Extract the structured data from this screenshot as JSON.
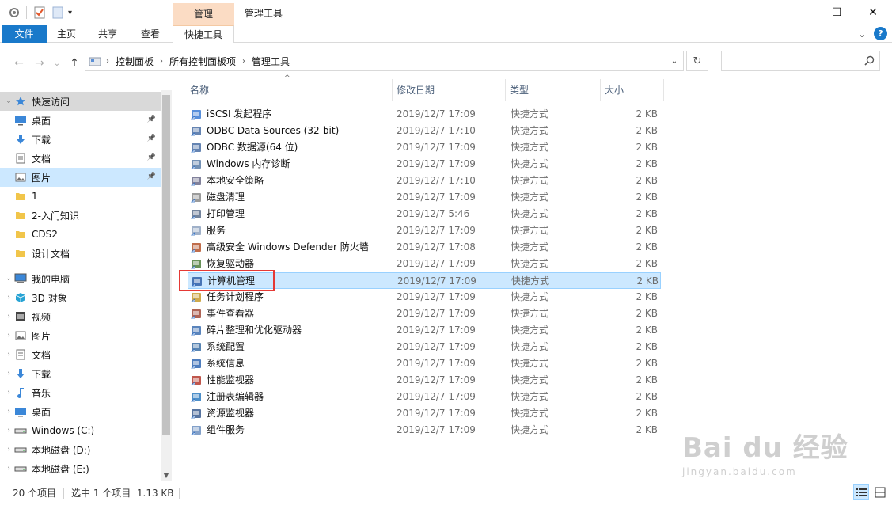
{
  "window": {
    "title": "管理工具",
    "context_tab_group": "管理",
    "controls": {
      "minimize": "—",
      "maximize": "☐",
      "close": "✕"
    }
  },
  "ribbon": {
    "tabs": [
      {
        "label": "文件"
      },
      {
        "label": "主页"
      },
      {
        "label": "共享"
      },
      {
        "label": "查看"
      },
      {
        "label": "快捷工具"
      }
    ],
    "expand": "⌄",
    "help": "?"
  },
  "address": {
    "crumbs": [
      "控制面板",
      "所有控制面板项",
      "管理工具"
    ],
    "nav": {
      "back": "←",
      "forward": "→",
      "recent": "⌄",
      "up": "↑"
    },
    "dropdown": "⌄",
    "refresh": "↻",
    "search_placeholder": ""
  },
  "navpane": {
    "items": [
      {
        "label": "快速访问",
        "icon": "star-icon",
        "color": "#3b87d8"
      },
      {
        "label": "桌面",
        "icon": "desktop-icon",
        "color": "#3b87d8"
      },
      {
        "label": "下载",
        "icon": "download-icon",
        "color": "#3b87d8"
      },
      {
        "label": "文档",
        "icon": "document-icon",
        "color": "#6d6d6d"
      },
      {
        "label": "图片",
        "icon": "picture-icon",
        "color": "#6d6d6d"
      },
      {
        "label": "1",
        "icon": "folder-icon",
        "color": "#f1c54a"
      },
      {
        "label": "2-入门知识",
        "icon": "folder-icon",
        "color": "#f1c54a"
      },
      {
        "label": "CDS2",
        "icon": "folder-icon",
        "color": "#f1c54a"
      },
      {
        "label": "设计文档",
        "icon": "folder-icon",
        "color": "#f1c54a"
      },
      {
        "label": "我的电脑",
        "icon": "computer-icon",
        "color": "#3b87d8"
      },
      {
        "label": "3D 对象",
        "icon": "3d-objects-icon",
        "color": "#27a3d4"
      },
      {
        "label": "视频",
        "icon": "video-icon",
        "color": "#444444"
      },
      {
        "label": "图片",
        "icon": "picture-icon",
        "color": "#6d6d6d"
      },
      {
        "label": "文档",
        "icon": "document-icon",
        "color": "#6d6d6d"
      },
      {
        "label": "下载",
        "icon": "download-icon",
        "color": "#3b87d8"
      },
      {
        "label": "音乐",
        "icon": "music-icon",
        "color": "#3b87d8"
      },
      {
        "label": "桌面",
        "icon": "desktop-icon",
        "color": "#3b87d8"
      },
      {
        "label": "Windows (C:)",
        "icon": "drive-icon",
        "color": "#555555"
      },
      {
        "label": "本地磁盘 (D:)",
        "icon": "drive-icon",
        "color": "#555555"
      },
      {
        "label": "本地磁盘 (E:)",
        "icon": "drive-icon",
        "color": "#555555"
      }
    ]
  },
  "filelist": {
    "columns": [
      "名称",
      "修改日期",
      "类型",
      "大小"
    ],
    "sort_indicator": "^",
    "rows": [
      {
        "name": "iSCSI 发起程序",
        "date": "2019/12/7 17:09",
        "type": "快捷方式",
        "size": "2 KB",
        "icon": "iscsi-icon",
        "color": "#3a7bd5"
      },
      {
        "name": "ODBC Data Sources (32-bit)",
        "date": "2019/12/7 17:10",
        "type": "快捷方式",
        "size": "2 KB",
        "icon": "odbc-icon",
        "color": "#4a6fa5"
      },
      {
        "name": "ODBC 数据源(64 位)",
        "date": "2019/12/7 17:09",
        "type": "快捷方式",
        "size": "2 KB",
        "icon": "odbc-icon",
        "color": "#4a6fa5"
      },
      {
        "name": "Windows 内存诊断",
        "date": "2019/12/7 17:09",
        "type": "快捷方式",
        "size": "2 KB",
        "icon": "memory-diagnostic-icon",
        "color": "#5b7ea8"
      },
      {
        "name": "本地安全策略",
        "date": "2019/12/7 17:10",
        "type": "快捷方式",
        "size": "2 KB",
        "icon": "security-policy-icon",
        "color": "#6b6b8a"
      },
      {
        "name": "磁盘清理",
        "date": "2019/12/7 17:09",
        "type": "快捷方式",
        "size": "2 KB",
        "icon": "disk-cleanup-icon",
        "color": "#8a8a8a"
      },
      {
        "name": "打印管理",
        "date": "2019/12/7 5:46",
        "type": "快捷方式",
        "size": "2 KB",
        "icon": "print-management-icon",
        "color": "#5a6e8c"
      },
      {
        "name": "服务",
        "date": "2019/12/7 17:09",
        "type": "快捷方式",
        "size": "2 KB",
        "icon": "services-icon",
        "color": "#8fa3bf"
      },
      {
        "name": "高级安全 Windows Defender 防火墙",
        "date": "2019/12/7 17:08",
        "type": "快捷方式",
        "size": "2 KB",
        "icon": "firewall-icon",
        "color": "#b5542b"
      },
      {
        "name": "恢复驱动器",
        "date": "2019/12/7 17:09",
        "type": "快捷方式",
        "size": "2 KB",
        "icon": "recovery-drive-icon",
        "color": "#4d7f3c"
      },
      {
        "name": "计算机管理",
        "date": "2019/12/7 17:09",
        "type": "快捷方式",
        "size": "2 KB",
        "icon": "computer-management-icon",
        "color": "#2f5fa8"
      },
      {
        "name": "任务计划程序",
        "date": "2019/12/7 17:09",
        "type": "快捷方式",
        "size": "2 KB",
        "icon": "task-scheduler-icon",
        "color": "#c69b2e"
      },
      {
        "name": "事件查看器",
        "date": "2019/12/7 17:09",
        "type": "快捷方式",
        "size": "2 KB",
        "icon": "event-viewer-icon",
        "color": "#a14a3a"
      },
      {
        "name": "碎片整理和优化驱动器",
        "date": "2019/12/7 17:09",
        "type": "快捷方式",
        "size": "2 KB",
        "icon": "defrag-icon",
        "color": "#3d6fb0"
      },
      {
        "name": "系统配置",
        "date": "2019/12/7 17:09",
        "type": "快捷方式",
        "size": "2 KB",
        "icon": "system-config-icon",
        "color": "#3b6ea5"
      },
      {
        "name": "系统信息",
        "date": "2019/12/7 17:09",
        "type": "快捷方式",
        "size": "2 KB",
        "icon": "system-info-icon",
        "color": "#2f66b3"
      },
      {
        "name": "性能监视器",
        "date": "2019/12/7 17:09",
        "type": "快捷方式",
        "size": "2 KB",
        "icon": "performance-monitor-icon",
        "color": "#b53a2e"
      },
      {
        "name": "注册表编辑器",
        "date": "2019/12/7 17:09",
        "type": "快捷方式",
        "size": "2 KB",
        "icon": "registry-editor-icon",
        "color": "#2e7bbf"
      },
      {
        "name": "资源监视器",
        "date": "2019/12/7 17:09",
        "type": "快捷方式",
        "size": "2 KB",
        "icon": "resource-monitor-icon",
        "color": "#3a5c8f"
      },
      {
        "name": "组件服务",
        "date": "2019/12/7 17:09",
        "type": "快捷方式",
        "size": "2 KB",
        "icon": "component-services-icon",
        "color": "#6c8fbf"
      }
    ]
  },
  "status": {
    "count": "20 个项目",
    "selection": "选中 1 个项目  1.13 KB"
  },
  "watermark": {
    "logo": "Bai du 经验",
    "sub": "jingyan.baidu.com"
  },
  "colors": {
    "accent": "#1979ca",
    "selection": "#cce8ff",
    "highlight_box": "#e53935"
  }
}
